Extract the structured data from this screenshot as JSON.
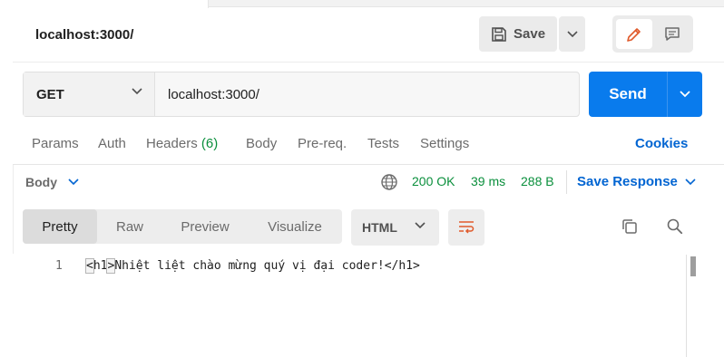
{
  "request": {
    "title": "localhost:3000/",
    "save_label": "Save",
    "method": "GET",
    "url": "localhost:3000/",
    "send_label": "Send"
  },
  "request_tabs": [
    {
      "label": "Params"
    },
    {
      "label": "Auth"
    },
    {
      "label": "Headers",
      "count": "(6)"
    },
    {
      "label": "Body"
    },
    {
      "label": "Pre-req."
    },
    {
      "label": "Tests"
    },
    {
      "label": "Settings"
    }
  ],
  "cookies_label": "Cookies",
  "response": {
    "body_label": "Body",
    "status": "200 OK",
    "time": "39 ms",
    "size": "288 B",
    "save_response_label": "Save Response",
    "views": [
      {
        "label": "Pretty",
        "active": true
      },
      {
        "label": "Raw",
        "active": false
      },
      {
        "label": "Preview",
        "active": false
      },
      {
        "label": "Visualize",
        "active": false
      }
    ],
    "format": "HTML",
    "code_lines": [
      {
        "line": "1",
        "open_bracket": "<",
        "tag_open": "h1",
        "close_bracket": ">",
        "text": "Nhiệt liệt chào mừng quý vị đại coder!",
        "tag_close": "</h1>"
      }
    ]
  },
  "icons": {
    "save": "save-icon",
    "edit": "pencil-icon",
    "comment": "comment-icon",
    "globe": "globe-icon",
    "wrap": "wrap-lines-icon",
    "copy": "copy-icon",
    "search": "search-icon"
  },
  "colors": {
    "send": "#097bed",
    "link": "#0265d2",
    "status_ok": "#0a8f3c",
    "accent_orange": "#e05a2b"
  }
}
